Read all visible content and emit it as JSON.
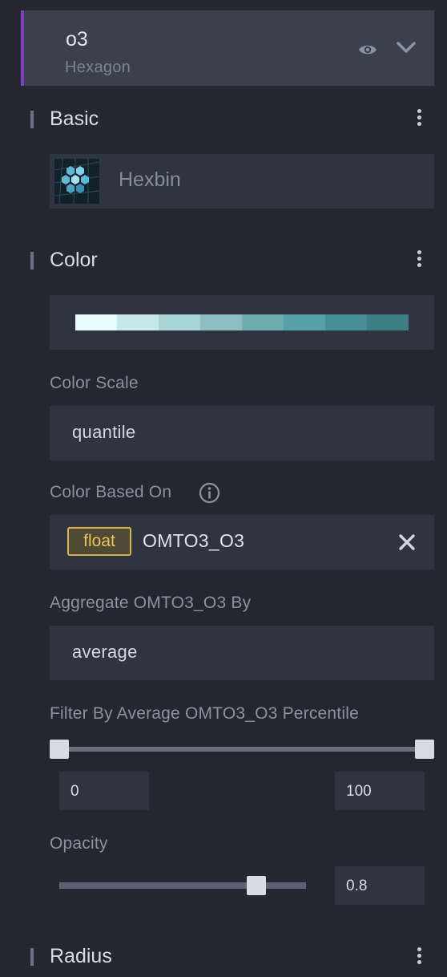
{
  "layer": {
    "title": "o3",
    "type": "Hexagon",
    "accent_color": "#7b3fc3",
    "visibility_icon": "eye-icon",
    "collapse_icon": "chevron-down-icon"
  },
  "basic": {
    "title": "Basic",
    "layer_type_label": "Hexbin",
    "menu_icon": "kebab-icon"
  },
  "color": {
    "title": "Color",
    "palette": [
      "#eafbfb",
      "#c5e8e9",
      "#a9d4d6",
      "#8cbfc2",
      "#6eacb1",
      "#56a0a7",
      "#468f96",
      "#3d7d84"
    ],
    "scale_label": "Color Scale",
    "scale_value": "quantile",
    "based_on_label": "Color Based On",
    "field_type": "float",
    "field_name": "OMTO3_O3",
    "aggregate_label": "Aggregate OMTO3_O3 By",
    "aggregate_value": "average",
    "filter_label": "Filter By Average OMTO3_O3 Percentile",
    "filter_min": "0",
    "filter_max": "100",
    "opacity_label": "Opacity",
    "opacity_value": "0.8"
  },
  "radius": {
    "title": "Radius"
  }
}
